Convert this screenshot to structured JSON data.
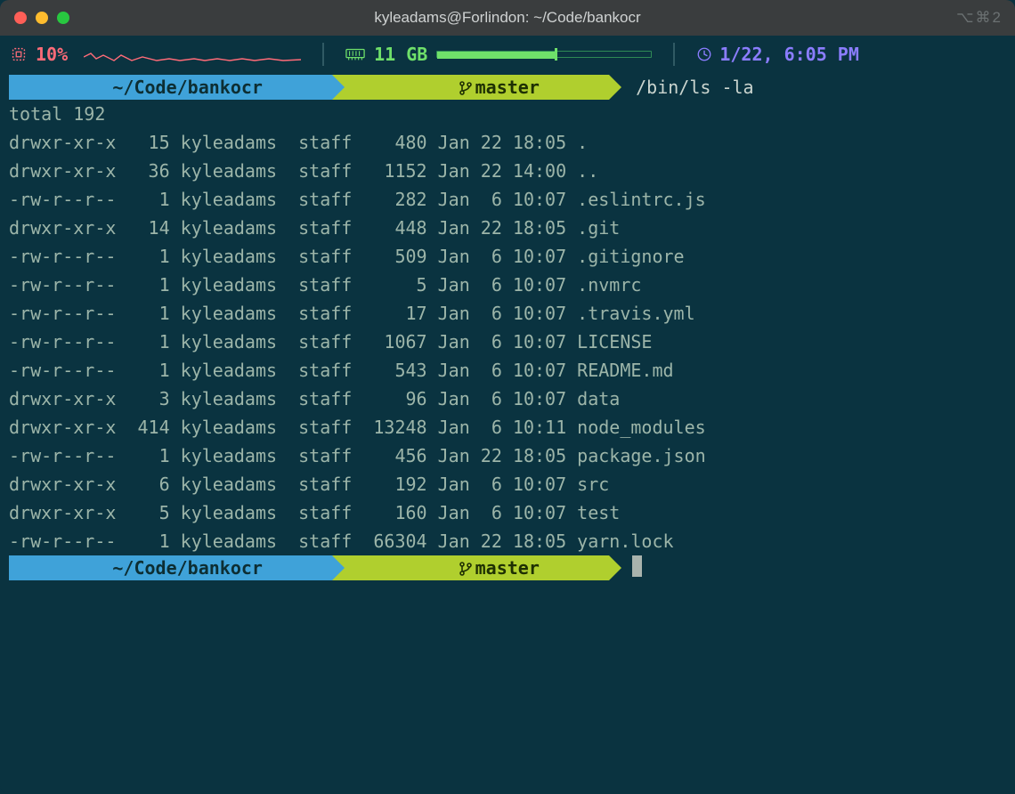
{
  "window": {
    "title": "kyleadams@Forlindon: ~/Code/bankocr",
    "shortcut": "⌥⌘2"
  },
  "status": {
    "cpu_percent": "10%",
    "ram_label": "11 GB",
    "clock": "1/22, 6:05 PM"
  },
  "prompt1": {
    "path": "~/Code/bankocr",
    "branch": "master",
    "command": "/bin/ls -la"
  },
  "prompt2": {
    "path": "~/Code/bankocr",
    "branch": "master"
  },
  "ls": {
    "total": "total 192",
    "rows": [
      {
        "perm": "drwxr-xr-x",
        "links": "15",
        "user": "kyleadams",
        "group": "staff",
        "size": "480",
        "date": "Jan 22 18:05",
        "name": "."
      },
      {
        "perm": "drwxr-xr-x",
        "links": "36",
        "user": "kyleadams",
        "group": "staff",
        "size": "1152",
        "date": "Jan 22 14:00",
        "name": ".."
      },
      {
        "perm": "-rw-r--r--",
        "links": "1",
        "user": "kyleadams",
        "group": "staff",
        "size": "282",
        "date": "Jan  6 10:07",
        "name": ".eslintrc.js"
      },
      {
        "perm": "drwxr-xr-x",
        "links": "14",
        "user": "kyleadams",
        "group": "staff",
        "size": "448",
        "date": "Jan 22 18:05",
        "name": ".git"
      },
      {
        "perm": "-rw-r--r--",
        "links": "1",
        "user": "kyleadams",
        "group": "staff",
        "size": "509",
        "date": "Jan  6 10:07",
        "name": ".gitignore"
      },
      {
        "perm": "-rw-r--r--",
        "links": "1",
        "user": "kyleadams",
        "group": "staff",
        "size": "5",
        "date": "Jan  6 10:07",
        "name": ".nvmrc"
      },
      {
        "perm": "-rw-r--r--",
        "links": "1",
        "user": "kyleadams",
        "group": "staff",
        "size": "17",
        "date": "Jan  6 10:07",
        "name": ".travis.yml"
      },
      {
        "perm": "-rw-r--r--",
        "links": "1",
        "user": "kyleadams",
        "group": "staff",
        "size": "1067",
        "date": "Jan  6 10:07",
        "name": "LICENSE"
      },
      {
        "perm": "-rw-r--r--",
        "links": "1",
        "user": "kyleadams",
        "group": "staff",
        "size": "543",
        "date": "Jan  6 10:07",
        "name": "README.md"
      },
      {
        "perm": "drwxr-xr-x",
        "links": "3",
        "user": "kyleadams",
        "group": "staff",
        "size": "96",
        "date": "Jan  6 10:07",
        "name": "data"
      },
      {
        "perm": "drwxr-xr-x",
        "links": "414",
        "user": "kyleadams",
        "group": "staff",
        "size": "13248",
        "date": "Jan  6 10:11",
        "name": "node_modules"
      },
      {
        "perm": "-rw-r--r--",
        "links": "1",
        "user": "kyleadams",
        "group": "staff",
        "size": "456",
        "date": "Jan 22 18:05",
        "name": "package.json"
      },
      {
        "perm": "drwxr-xr-x",
        "links": "6",
        "user": "kyleadams",
        "group": "staff",
        "size": "192",
        "date": "Jan  6 10:07",
        "name": "src"
      },
      {
        "perm": "drwxr-xr-x",
        "links": "5",
        "user": "kyleadams",
        "group": "staff",
        "size": "160",
        "date": "Jan  6 10:07",
        "name": "test"
      },
      {
        "perm": "-rw-r--r--",
        "links": "1",
        "user": "kyleadams",
        "group": "staff",
        "size": "66304",
        "date": "Jan 22 18:05",
        "name": "yarn.lock"
      }
    ]
  }
}
